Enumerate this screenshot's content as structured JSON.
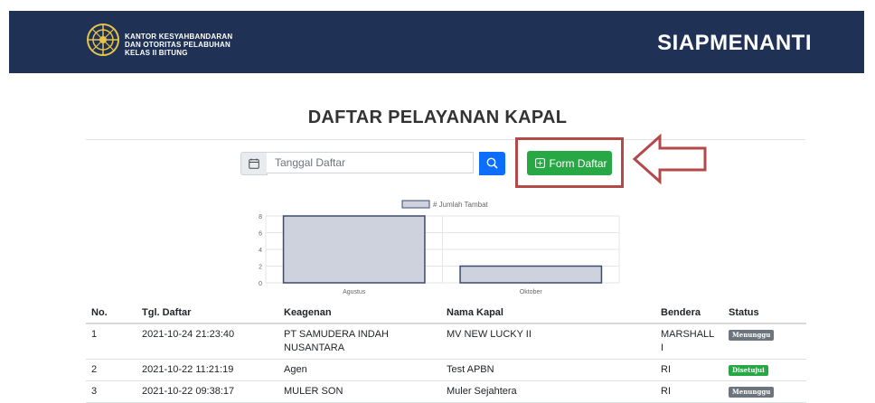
{
  "header": {
    "logo_lines": [
      "KANTOR KESYAHBANDARAN",
      "DAN OTORITAS PELABUHAN",
      "KELAS II BITUNG"
    ],
    "app_title": "SIAPMENANTI",
    "navy": "#1f3154"
  },
  "page": {
    "title": "DAFTAR PELAYANAN KAPAL"
  },
  "search": {
    "placeholder": "Tanggal Daftar",
    "calendar_icon": "calendar-icon",
    "search_icon": "magnifier-icon"
  },
  "form_button": {
    "label": "Form Daftar",
    "icon": "plus-square-icon",
    "color": "#28a745"
  },
  "chart_data": {
    "type": "bar",
    "categories": [
      "Agustus",
      "Oktober"
    ],
    "series": [
      {
        "name": "# Jumlah Tambat",
        "values": [
          8,
          2
        ]
      }
    ],
    "ylim": [
      0,
      8
    ],
    "yticks": [
      0,
      2,
      4,
      6,
      8
    ],
    "legend": "top-center",
    "grid": true,
    "bar_fill": "#ced2dc",
    "bar_stroke": "#3b4a72"
  },
  "table": {
    "headers": [
      "No.",
      "Tgl. Daftar",
      "Keagenan",
      "Nama Kapal",
      "Bendera",
      "Status"
    ],
    "rows": [
      {
        "no": "1",
        "date": "2021-10-24 21:23:40",
        "agent_1": "PT SAMUDERA INDAH",
        "agent_2": "NUSANTARA",
        "ship": "MV NEW LUCKY II",
        "flag": "MARSHALL I",
        "status": "Menunggu"
      },
      {
        "no": "2",
        "date": "2021-10-22 11:21:19",
        "agent_1": "Agen",
        "agent_2": "",
        "ship": "Test APBN",
        "flag": "RI",
        "status": "Disetujui"
      },
      {
        "no": "3",
        "date": "2021-10-22 09:38:17",
        "agent_1": "MULER SON",
        "agent_2": "",
        "ship": "Muler Sejahtera",
        "flag": "RI",
        "status": "Menunggu"
      }
    ]
  },
  "annotation": {
    "color": "#b34949"
  }
}
